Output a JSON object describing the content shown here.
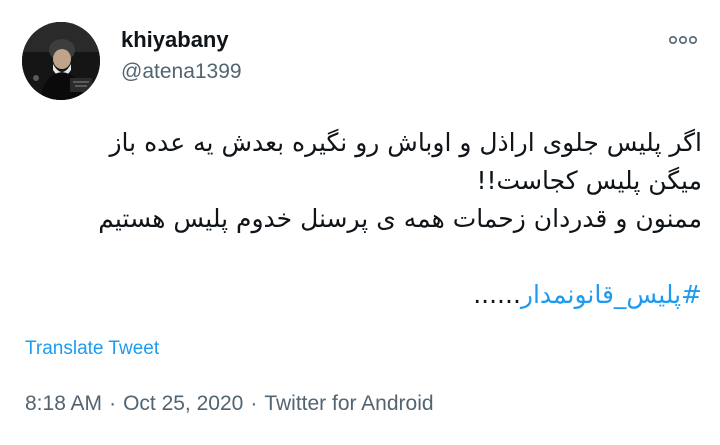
{
  "author": {
    "display_name": "khiyabany",
    "handle": "@atena1399",
    "avatar_icon": "profile-photo"
  },
  "more_icon": "more-options-icon",
  "tweet": {
    "lines": [
      "اگر پلیس جلوی اراذل و اوباش رو نگیره بعدش یه عده باز",
      "میگن پلیس کجاست!!",
      "ممنون و قدردان زحمات همه ی پرسنل خدوم پلیس هستیم"
    ],
    "hashtag": "#پلیس_قانونمدار",
    "hashtag_suffix": "......"
  },
  "translate_label": "Translate Tweet",
  "meta": {
    "time": "8:18 AM",
    "separator": "·",
    "date": "Oct 25, 2020",
    "source": "Twitter for Android"
  },
  "colors": {
    "link": "#1d9bf0",
    "secondary_text": "#536471",
    "primary_text": "#0f1419"
  }
}
